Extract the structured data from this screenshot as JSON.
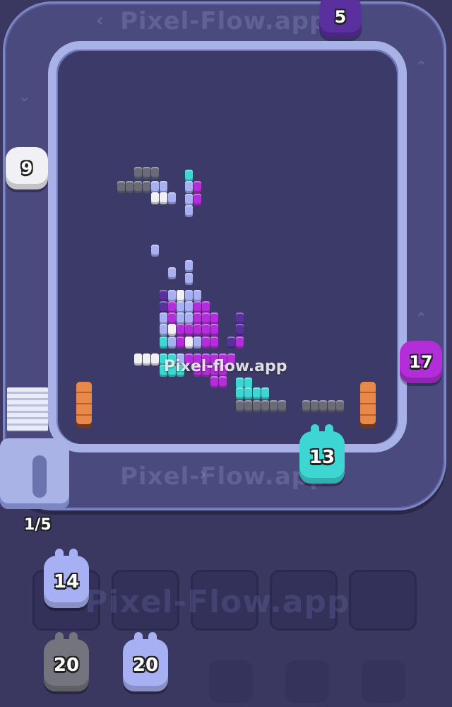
{
  "watermark": {
    "text": "Pixel-Flow.app",
    "center_text": "Pixel-flow.app"
  },
  "queue": {
    "counter": "1/5",
    "slots_total": 5
  },
  "shooters_on_track": [
    {
      "name": "shooter-purple-top",
      "count": "5",
      "color": "#5a2f9e"
    },
    {
      "name": "shooter-white-left",
      "count": "9",
      "color": "#f0f0f5"
    },
    {
      "name": "shooter-magenta-right",
      "count": "17",
      "color": "#b12ed8"
    },
    {
      "name": "shooter-cyan-bottom",
      "count": "13",
      "color": "#3ed6d2"
    }
  ],
  "waiting_shooters": [
    {
      "name": "waiting-shooter-lavender-1",
      "count": "14",
      "color": "#a6b0f2"
    },
    {
      "name": "waiting-shooter-gray",
      "count": "20",
      "color": "#74747f"
    },
    {
      "name": "waiting-shooter-lavender-2",
      "count": "20",
      "color": "#a6b0f2"
    }
  ],
  "colors": {
    "background": "#3a3760",
    "track": "#4a4a7e",
    "rail": "#a8b2e6",
    "purple": "#5a2f9e",
    "magenta": "#b12ed8",
    "cyan": "#3ed6d2",
    "white": "#f0f0f5",
    "gray": "#6b6b78",
    "lavender": "#a6b0f2",
    "wood": "#e8894a"
  },
  "icons": [
    "chevron-left-icon",
    "chevron-up-icon",
    "chevron-down-icon",
    "stairs-icon",
    "wood-block-icon"
  ]
}
